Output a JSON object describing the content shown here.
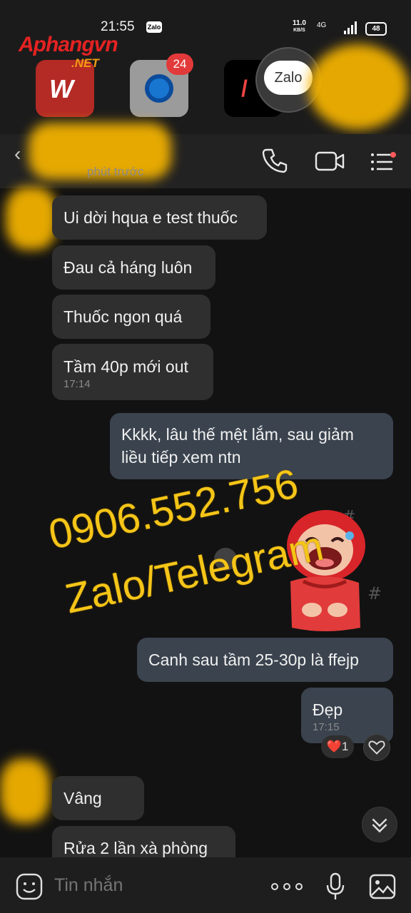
{
  "status_bar": {
    "time": "21:55",
    "notif_app": "Zalo",
    "net_speed_value": "11.0",
    "net_speed_unit": "KB/S",
    "network": "4G",
    "battery": "48"
  },
  "launcher": {
    "badge_count": "24",
    "zalo_bubble_label": "Zalo"
  },
  "watermark_logo": {
    "name": "Aphangvn",
    "suffix": ".NET"
  },
  "header": {
    "last_seen": "phút trước"
  },
  "messages": [
    {
      "text": "Ui dời hqua e test thuốc"
    },
    {
      "text": "Đau cả háng luôn"
    },
    {
      "text": "Thuốc ngon quá"
    },
    {
      "text": "Tầm 40p mới out",
      "time": "17:14"
    },
    {
      "text": "Kkkk, lâu thế mệt lắm, sau giảm liều tiếp xem ntn"
    },
    {
      "text": "Canh sau tầm 25-30p là ffejp"
    },
    {
      "text": "Đẹp",
      "time": "17:15"
    },
    {
      "text": "Vâng"
    },
    {
      "text": "Rửa 2 lần xà phòng"
    }
  ],
  "reaction": {
    "emoji": "❤️",
    "count": "1"
  },
  "overlay_text": {
    "phone": "0906.552.756",
    "apps": "Zalo/Telegram"
  },
  "composer": {
    "placeholder": "Tin nhắn"
  },
  "colors": {
    "background": "#121212",
    "incoming_bubble": "#2f2f2f",
    "outgoing_bubble": "#3a434e",
    "overlay_yellow": "#f5c518",
    "logo_red": "#e52222"
  }
}
